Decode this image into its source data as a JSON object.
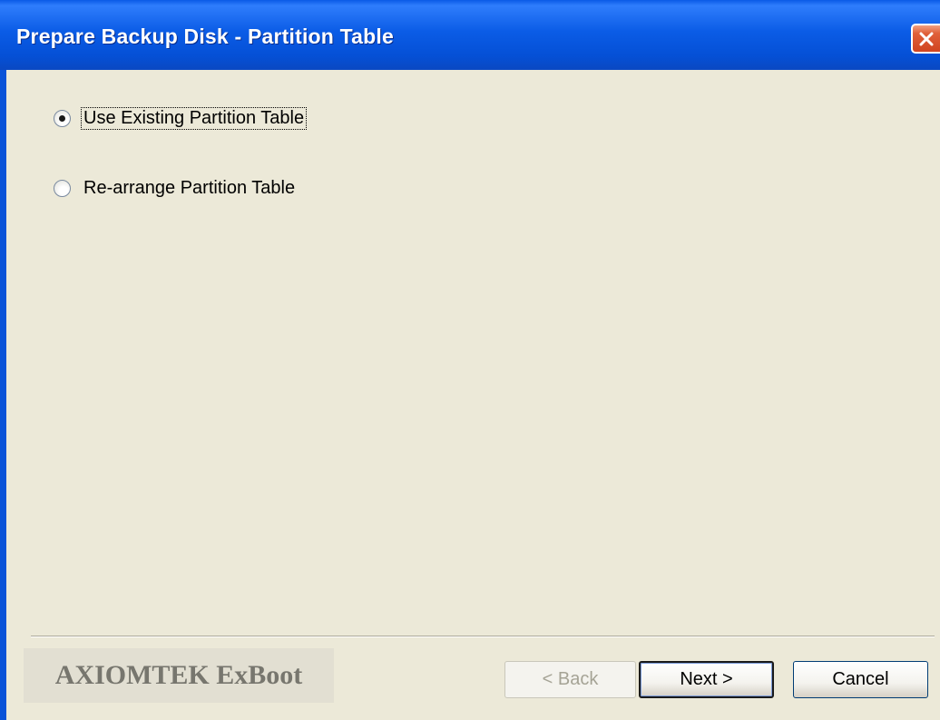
{
  "window": {
    "title": "Prepare Backup Disk - Partition Table",
    "close_icon": "close-icon"
  },
  "options": [
    {
      "label": "Use Existing Partition Table",
      "selected": true
    },
    {
      "label": "Re-arrange Partition Table",
      "selected": false
    }
  ],
  "footer": {
    "brand": "AXIOMTEK ExBoot",
    "back_label": "< Back",
    "next_label": "Next >",
    "cancel_label": "Cancel",
    "back_enabled": false
  },
  "colors": {
    "titlebar": "#0a5ae6",
    "close_button": "#e0603a",
    "client_background": "#ece9d8"
  }
}
